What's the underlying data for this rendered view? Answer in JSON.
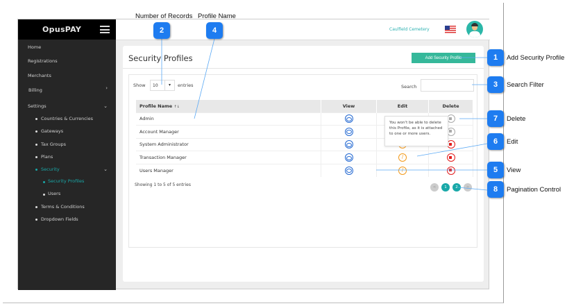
{
  "sidebar": {
    "brand": "OpusPAY",
    "items": [
      {
        "label": "Home"
      },
      {
        "label": "Registrations"
      },
      {
        "label": "Merchants"
      },
      {
        "label": "Billing"
      },
      {
        "label": "Settings"
      },
      {
        "label": "Countries & Currencies"
      },
      {
        "label": "Gateways"
      },
      {
        "label": "Tax Groups"
      },
      {
        "label": "Plans"
      },
      {
        "label": "Security"
      },
      {
        "label": "Security Profiles"
      },
      {
        "label": "Users"
      },
      {
        "label": "Terms & Conditions"
      },
      {
        "label": "Dropdown Fields"
      }
    ]
  },
  "header": {
    "organization": "Caulfield Cemetery"
  },
  "page": {
    "title": "Security Profiles",
    "add_button": "Add Security Profile",
    "show_label": "Show",
    "entries_label": "entries",
    "page_size": "10",
    "search_label": "Search",
    "search_value": "",
    "columns": [
      "Profile Name",
      "View",
      "Edit",
      "Delete"
    ],
    "sort_icon": "↑↓",
    "rows": [
      {
        "name": "Admin",
        "deletable": false,
        "editable": false
      },
      {
        "name": "Account Manager",
        "deletable": false,
        "editable": false
      },
      {
        "name": "System Administrator",
        "deletable": true,
        "editable": true
      },
      {
        "name": "Transaction Manager",
        "deletable": true,
        "editable": true
      },
      {
        "name": "Users Manager",
        "deletable": true,
        "editable": true
      }
    ],
    "tooltip": "You won't be able to delete this Profile, as it is attached to one or more users.",
    "info": "Showing 1 to 5 of 5 entries",
    "pagination": {
      "prev": "<",
      "pages": [
        "1",
        "2"
      ],
      "next": ">"
    }
  },
  "callouts": [
    {
      "num": "1",
      "label": "Add Security Profile"
    },
    {
      "num": "2",
      "label": "Number of Records"
    },
    {
      "num": "3",
      "label": "Search Filter"
    },
    {
      "num": "4",
      "label": "Profile Name"
    },
    {
      "num": "5",
      "label": "View"
    },
    {
      "num": "6",
      "label": "Edit"
    },
    {
      "num": "7",
      "label": "Delete"
    },
    {
      "num": "8",
      "label": "Pagination Control"
    }
  ],
  "colors": {
    "accent": "#19a8a8",
    "button": "#35b89a",
    "view": "#2167d1",
    "edit": "#f39a1b",
    "delete": "#e31b1b",
    "callout": "#1e7cf0"
  }
}
